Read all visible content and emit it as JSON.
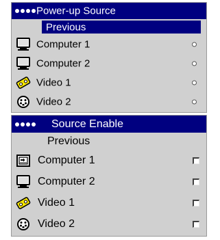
{
  "power_up": {
    "title": "Power-up Source",
    "selected": "Previous",
    "items": [
      {
        "label": "Computer 1",
        "icon": "monitor-icon"
      },
      {
        "label": "Computer 2",
        "icon": "monitor-icon"
      },
      {
        "label": "Video 1",
        "icon": "video-cassette-icon"
      },
      {
        "label": "Video 2",
        "icon": "s-video-connector-icon"
      }
    ]
  },
  "source_enable": {
    "title": "Source Enable",
    "previous": "Previous",
    "items": [
      {
        "label": "Computer 1",
        "icon": "computer-input-icon"
      },
      {
        "label": "Computer 2",
        "icon": "monitor-icon"
      },
      {
        "label": "Video 1",
        "icon": "video-cassette-icon"
      },
      {
        "label": "Video 2",
        "icon": "s-video-connector-icon"
      }
    ]
  },
  "colors": {
    "title_bar": "#000080",
    "panel_bg": "#d0d0d0",
    "highlight": "#000080"
  }
}
